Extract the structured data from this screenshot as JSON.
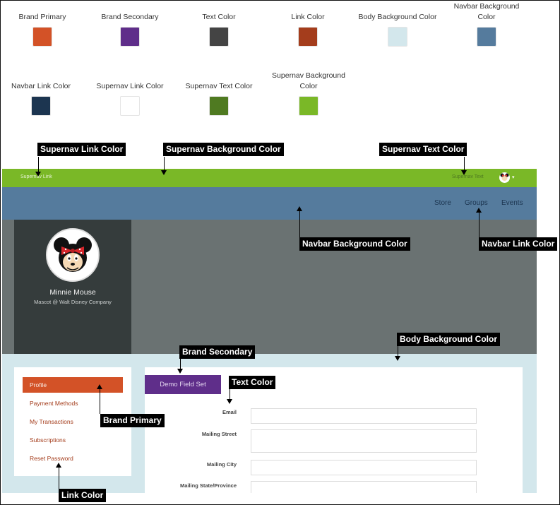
{
  "swatches": [
    {
      "label": "Brand Primary",
      "color": "#d35227"
    },
    {
      "label": "Brand Secondary",
      "color": "#5f2e8a"
    },
    {
      "label": "Text Color",
      "color": "#444444"
    },
    {
      "label": "Link Color",
      "color": "#a43d1c"
    },
    {
      "label": "Body Background Color",
      "color": "#d3e7ec"
    },
    {
      "label": "Navbar Background Color",
      "color": "#557b9d"
    },
    {
      "label": "Navbar Link Color",
      "color": "#1c3550"
    },
    {
      "label": "Supernav Link Color",
      "color": "#ffffff"
    },
    {
      "label": "Supernav Text Color",
      "color": "#4f7a21"
    },
    {
      "label": "Supernav Background Color",
      "color": "#7ab827"
    }
  ],
  "mock": {
    "supernav": {
      "link": "Supernav Link",
      "text": "Supernav Text",
      "caret": "▾"
    },
    "navbar": {
      "links": [
        "Store",
        "Groups",
        "Events"
      ]
    },
    "profile": {
      "name": "Minnie Mouse",
      "subtitle": "Mascot @ Walt Disney Company"
    },
    "menu": [
      "Profile",
      "Payment Methods",
      "My Transactions",
      "Subscriptions",
      "Reset Password"
    ],
    "fieldset_button": "Demo Field Set",
    "fields": [
      "Email",
      "Mailing Street",
      "Mailing City",
      "Mailing State/Province"
    ]
  },
  "callouts": {
    "supernav_link": "Supernav Link Color",
    "supernav_bg": "Supernav Background Color",
    "supernav_text": "Supernav Text Color",
    "navbar_bg": "Navbar Background Color",
    "navbar_link": "Navbar Link Color",
    "body_bg": "Body Background Color",
    "brand_secondary": "Brand Secondary",
    "text_color": "Text Color",
    "brand_primary": "Brand Primary",
    "link_color": "Link Color"
  }
}
